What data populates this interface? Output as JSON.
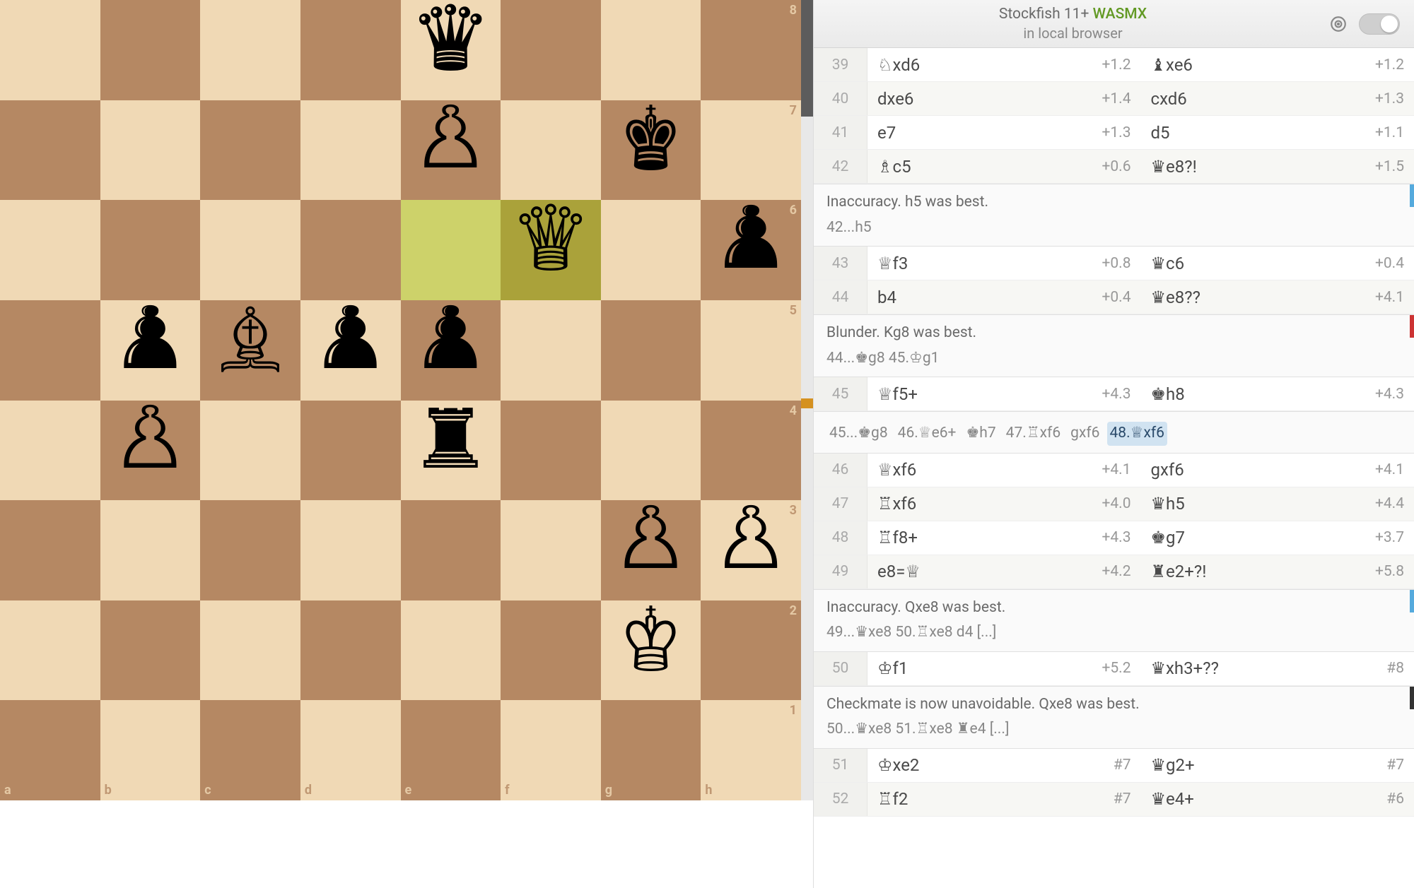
{
  "engine": {
    "name": "Stockfish 11+",
    "tech": "WASMX",
    "location": "in local browser",
    "enabled": false
  },
  "board": {
    "files": [
      "a",
      "b",
      "c",
      "d",
      "e",
      "f",
      "g",
      "h"
    ],
    "ranks": [
      "8",
      "7",
      "6",
      "5",
      "4",
      "3",
      "2",
      "1"
    ],
    "highlights": [
      "e6",
      "f6"
    ],
    "pieces": [
      {
        "sq": "e8",
        "g": "♛"
      },
      {
        "sq": "e7",
        "g": "♙"
      },
      {
        "sq": "g7",
        "g": "♚"
      },
      {
        "sq": "f6",
        "g": "♕"
      },
      {
        "sq": "h6",
        "g": "♟"
      },
      {
        "sq": "b5",
        "g": "♟"
      },
      {
        "sq": "c5",
        "g": "♗"
      },
      {
        "sq": "d5",
        "g": "♟"
      },
      {
        "sq": "e5",
        "g": "♟"
      },
      {
        "sq": "b4",
        "g": "♙"
      },
      {
        "sq": "e4",
        "g": "♜"
      },
      {
        "sq": "g3",
        "g": "♙"
      },
      {
        "sq": "h3",
        "g": "♙"
      },
      {
        "sq": "g2",
        "g": "♔"
      }
    ]
  },
  "moves": {
    "rows": [
      {
        "n": 39,
        "w": {
          "san": "♘xd6",
          "ev": "+1.2"
        },
        "b": {
          "san": "♝xe6",
          "ev": "+1.2"
        }
      },
      {
        "n": 40,
        "w": {
          "san": "dxe6",
          "ev": "+1.4"
        },
        "b": {
          "san": "cxd6",
          "ev": "+1.3"
        }
      },
      {
        "n": 41,
        "w": {
          "san": "e7",
          "ev": "+1.3"
        },
        "b": {
          "san": "d5",
          "ev": "+1.1"
        }
      },
      {
        "n": 42,
        "w": {
          "san": "♗c5",
          "ev": "+0.6"
        },
        "b": {
          "san": "♛e8?!",
          "ev": "+1.5"
        }
      }
    ],
    "comment1": {
      "text": "Inaccuracy. h5 was best.",
      "kind": "inacc",
      "variation": "42...h5"
    },
    "rows2": [
      {
        "n": 43,
        "w": {
          "san": "♕f3",
          "ev": "+0.8"
        },
        "b": {
          "san": "♛c6",
          "ev": "+0.4"
        }
      },
      {
        "n": 44,
        "w": {
          "san": "b4",
          "ev": "+0.4"
        },
        "b": {
          "san": "♛e8??",
          "ev": "+4.1"
        }
      }
    ],
    "comment2": {
      "text": "Blunder. Kg8 was best.",
      "kind": "blunder",
      "variation": "44...♚g8 45.♔g1"
    },
    "rows3": [
      {
        "n": 45,
        "w": {
          "san": "♕f5+",
          "ev": "+4.3"
        },
        "b": {
          "san": "♚h8",
          "ev": "+4.3"
        }
      }
    ],
    "variation3": {
      "parts": [
        "45...♚g8",
        "46.♕e6+",
        "♚h7",
        "47.♖xf6",
        "gxf6",
        "48.♕xf6"
      ],
      "current_index": 5
    },
    "rows4": [
      {
        "n": 46,
        "w": {
          "san": "♕xf6",
          "ev": "+4.1"
        },
        "b": {
          "san": "gxf6",
          "ev": "+4.1"
        }
      },
      {
        "n": 47,
        "w": {
          "san": "♖xf6",
          "ev": "+4.0"
        },
        "b": {
          "san": "♛h5",
          "ev": "+4.4"
        }
      },
      {
        "n": 48,
        "w": {
          "san": "♖f8+",
          "ev": "+4.3"
        },
        "b": {
          "san": "♚g7",
          "ev": "+3.7"
        }
      },
      {
        "n": 49,
        "w": {
          "san": "e8=♕",
          "ev": "+4.2"
        },
        "b": {
          "san": "♜e2+?!",
          "ev": "+5.8"
        }
      }
    ],
    "comment4": {
      "text": "Inaccuracy. Qxe8 was best.",
      "kind": "inacc",
      "variation": "49...♛xe8 50.♖xe8 d4 [...]"
    },
    "rows5": [
      {
        "n": 50,
        "w": {
          "san": "♔f1",
          "ev": "+5.2"
        },
        "b": {
          "san": "♛xh3+??",
          "ev": "#8"
        }
      }
    ],
    "comment5": {
      "text": "Checkmate is now unavoidable. Qxe8 was best.",
      "kind": "dark",
      "variation": "50...♛xe8 51.♖xe8 ♜e4 [...]"
    },
    "rows6": [
      {
        "n": 51,
        "w": {
          "san": "♔xe2",
          "ev": "#7"
        },
        "b": {
          "san": "♛g2+",
          "ev": "#7"
        }
      },
      {
        "n": 52,
        "w": {
          "san": "♖f2",
          "ev": "#7"
        },
        "b": {
          "san": "♛e4+",
          "ev": "#6"
        }
      }
    ]
  }
}
